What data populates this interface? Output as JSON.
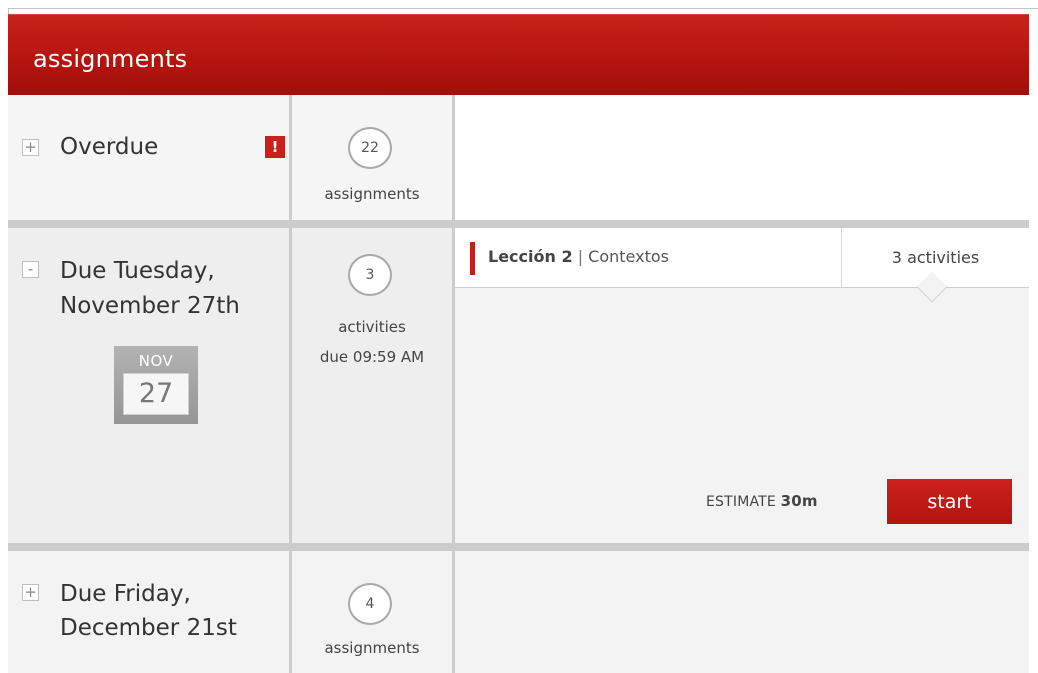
{
  "header": {
    "title": "assignments"
  },
  "groups": {
    "overdue": {
      "toggle": "+",
      "title": "Overdue",
      "alert": "!",
      "count": "22",
      "count_label": "assignments"
    },
    "nov": {
      "toggle": "-",
      "title_line1": "Due Tuesday,",
      "title_line2": "November 27th",
      "calendar": {
        "month": "NOV",
        "day": "27"
      },
      "count": "3",
      "count_label": "activities",
      "due_time": "due 09:59 AM",
      "lesson": {
        "name": "Lección 2",
        "separator": "|",
        "subtitle": "Contextos",
        "activities_tab": "3 activities"
      },
      "estimate_label": "ESTIMATE",
      "estimate_value": "30m",
      "start_label": "start"
    },
    "dec": {
      "toggle": "+",
      "title_line1": "Due Friday,",
      "title_line2": "December 21st",
      "count": "4",
      "count_label": "assignments"
    }
  },
  "colors": {
    "header_red": "#b6150f",
    "accent_red": "#c41f1b",
    "divider_gray": "#cccccc"
  }
}
